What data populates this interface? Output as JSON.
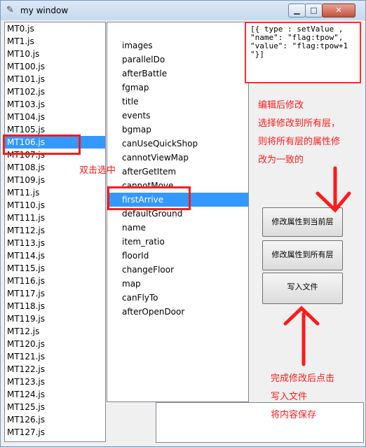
{
  "window": {
    "title": "my window",
    "minimize_glyph": "▁",
    "maximize_glyph": "□",
    "close_glyph": "✕",
    "icon_glyph": "✎"
  },
  "file_list": {
    "items": [
      "MT0.js",
      "MT1.js",
      "MT10.js",
      "MT100.js",
      "MT101.js",
      "MT102.js",
      "MT103.js",
      "MT104.js",
      "MT105.js",
      "MT106.js",
      "MT107.js",
      "MT108.js",
      "MT109.js",
      "MT11.js",
      "MT110.js",
      "MT111.js",
      "MT112.js",
      "MT113.js",
      "MT114.js",
      "MT115.js",
      "MT116.js",
      "MT117.js",
      "MT118.js",
      "MT119.js",
      "MT12.js",
      "MT120.js",
      "MT121.js",
      "MT122.js",
      "MT123.js",
      "MT124.js",
      "MT125.js",
      "MT126.js",
      "MT127.js"
    ],
    "selected": "MT106.js"
  },
  "property_list": {
    "items": [
      "images",
      "parallelDo",
      "afterBattle",
      "fgmap",
      "title",
      "events",
      "bgmap",
      "canUseQuickShop",
      "cannotViewMap",
      "afterGetItem",
      "cannotMove",
      "firstArrive",
      "defaultGround",
      "name",
      "item_ratio",
      "floorId",
      "changeFloor",
      "map",
      "canFlyTo",
      "afterOpenDoor"
    ],
    "selected": "firstArrive"
  },
  "value_text": "[{ type : setValue ,\n\"name\": \"flag:tpow\",\n\"value\": \"flag:tpow+1\n\"}]",
  "buttons": {
    "apply_current": "修改属性到当前层",
    "apply_all": "修改属性到所有层",
    "write_file": "写入文件"
  },
  "annotations": {
    "double_click": "双击选中",
    "edit_lines": [
      "编辑后修改",
      "选择修改到所有层，",
      "则将所有层的属性修",
      "改为一致的"
    ],
    "save_lines": [
      "完成修改后点击",
      "写入文件",
      "将内容保存"
    ]
  },
  "colors": {
    "selection": "#3399ff",
    "annotation_red": "#ff1a1a"
  }
}
